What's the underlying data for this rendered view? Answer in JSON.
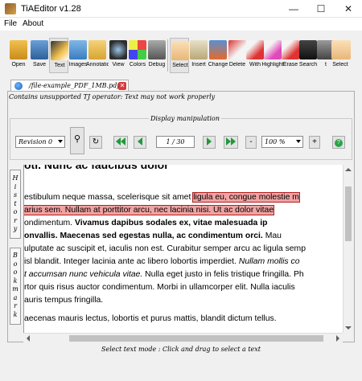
{
  "window": {
    "title": "TiAEditor v1.28",
    "minimize": "—",
    "maximize": "☐",
    "close": "✕"
  },
  "menu": {
    "file": "File",
    "about": "About"
  },
  "toolbar": {
    "open": "Open",
    "save": "Save",
    "text": "Text",
    "images": "Images",
    "annotations": "Annotations",
    "view": "View",
    "colors": "Colors",
    "debug": "Debug",
    "select": "Select",
    "insert": "Insert",
    "change": "Change",
    "delete": "Delete",
    "with": "With",
    "highlight": "Highlight",
    "erase": "Erase",
    "search": "Search",
    "t": "t",
    "select_big": "Select"
  },
  "tab": {
    "filename": "/file-example_PDF_1MB.pdf",
    "close": "✕"
  },
  "warning": "Contains unsupported TJ operator: Text may not work properly",
  "display": {
    "group_label": "Display manipulation",
    "revision": "Revision 0",
    "page": "1 / 30",
    "zoom": "100 %",
    "minus": "-",
    "plus": "+"
  },
  "side": {
    "history": [
      "H",
      "i",
      "s",
      "t",
      "o",
      "r",
      "y"
    ],
    "bookmarks": [
      "B",
      "o",
      "o",
      "k",
      "m",
      "a",
      "r",
      "k"
    ]
  },
  "document": {
    "lines": [
      "oti. Nunc ac faucibus dolor",
      "estibulum neque massa, scelerisque sit amet",
      "ligula eu, congue molestie m",
      "arius sem. Nullam at porttitor arcu, nec lacinia nisi. Ut ac dolor vitae",
      "ondimentum.",
      "Vivamus dapibus sodales ex, vitae malesuada ip",
      "onvallis. Maecenas sed egestas nulla, ac condimentum orci.",
      "Mau",
      "ulputate ac suscipit et, iaculis non est. Curabitur semper arcu ac ligula semp",
      "isl blandit. Integer lacinia ante ac libero lobortis imperdiet.",
      "Nullam mollis co",
      "t accumsan nunc vehicula vitae.",
      "Nulla eget justo in felis tristique fringilla. Ph",
      "rtor quis risus auctor condimentum. Morbi in ullamcorper elit. Nulla iaculis",
      "auris tempus fringilla.",
      "aecenas mauris lectus, lobortis et purus mattis, blandit dictum tellus."
    ]
  },
  "status": "Select text mode : Click and drag to select a text",
  "colors": {
    "highlight": "#f1a2a2",
    "nav_green": "#1e9a3a"
  }
}
